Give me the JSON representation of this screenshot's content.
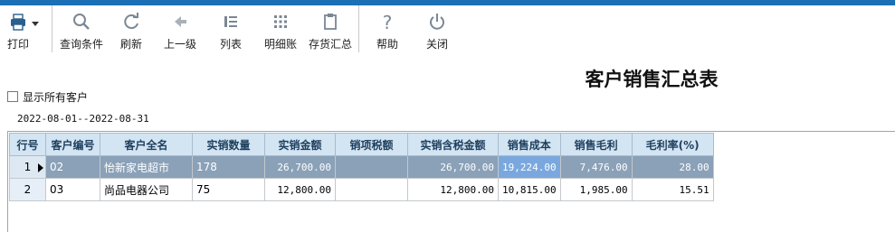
{
  "toolbar": {
    "print": "打印",
    "query": "查询条件",
    "refresh": "刷新",
    "up_level": "上一级",
    "list": "列表",
    "detail": "明细账",
    "inventory_summary": "存货汇总",
    "help": "帮助",
    "close": "关闭"
  },
  "report": {
    "title": "客户销售汇总表",
    "show_all_label": "显示所有客户",
    "show_all_checked": false,
    "date_range": "2022-08-01--2022-08-31"
  },
  "grid": {
    "columns": [
      "行号",
      "客户编号",
      "客户全名",
      "实销数量",
      "实销金额",
      "销项税额",
      "实销含税金额",
      "销售成本",
      "销售毛利",
      "毛利率(%)"
    ],
    "rows": [
      {
        "row_no": "1",
        "code": "02",
        "name": "怡新家电超市",
        "qty": "178",
        "amount": "26,700.00",
        "tax": "",
        "amount_tax": "26,700.00",
        "cost": "19,224.00",
        "profit": "7,476.00",
        "margin": "28.00"
      },
      {
        "row_no": "2",
        "code": "03",
        "name": "尚品电器公司",
        "qty": "75",
        "amount": "12,800.00",
        "tax": "",
        "amount_tax": "12,800.00",
        "cost": "10,815.00",
        "profit": "1,985.00",
        "margin": "15.51"
      }
    ]
  }
}
